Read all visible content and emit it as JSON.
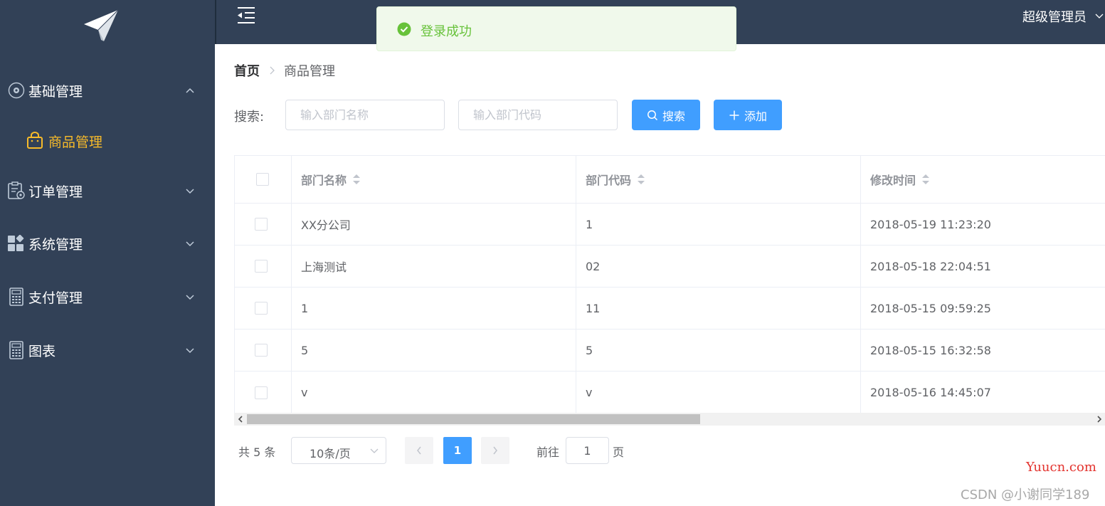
{
  "sidebar": {
    "menus": [
      {
        "label": "基础管理",
        "icon": "gear-circle-icon",
        "expanded": true
      },
      {
        "label": "订单管理",
        "icon": "clipboard-icon",
        "expanded": false
      },
      {
        "label": "系统管理",
        "icon": "grid-icon",
        "expanded": false
      },
      {
        "label": "支付管理",
        "icon": "calculator-icon",
        "expanded": false
      },
      {
        "label": "图表",
        "icon": "calculator-icon",
        "expanded": false
      }
    ],
    "active_submenu": {
      "label": "商品管理",
      "icon": "shopping-bag-icon"
    }
  },
  "header": {
    "username": "超级管理员"
  },
  "toast": {
    "message": "登录成功",
    "type": "success"
  },
  "breadcrumb": {
    "home": "首页",
    "current": "商品管理"
  },
  "search": {
    "label": "搜索:",
    "name_placeholder": "输入部门名称",
    "code_placeholder": "输入部门代码",
    "search_button": "搜索",
    "add_button": "添加"
  },
  "table": {
    "columns": [
      "部门名称",
      "部门代码",
      "修改时间"
    ],
    "rows": [
      {
        "name": "XX分公司",
        "code": "1",
        "time": "2018-05-19 11:23:20"
      },
      {
        "name": "上海测试",
        "code": "02",
        "time": "2018-05-18 22:04:51"
      },
      {
        "name": "1",
        "code": "11",
        "time": "2018-05-15 09:59:25"
      },
      {
        "name": "5",
        "code": "5",
        "time": "2018-05-15 16:32:58"
      },
      {
        "name": "v",
        "code": "v",
        "time": "2018-05-16 14:45:07"
      }
    ]
  },
  "pagination": {
    "total": "共 5 条",
    "page_size": "10条/页",
    "current_page": "1",
    "goto_label": "前往",
    "goto_value": "1",
    "goto_unit": "页"
  },
  "watermarks": {
    "site": "Yuucn.com",
    "author": "CSDN @小谢同学189"
  },
  "colors": {
    "sidebar_bg": "#324157",
    "primary": "#409eff",
    "active": "#f7ba2a",
    "success": "#67c23a"
  }
}
